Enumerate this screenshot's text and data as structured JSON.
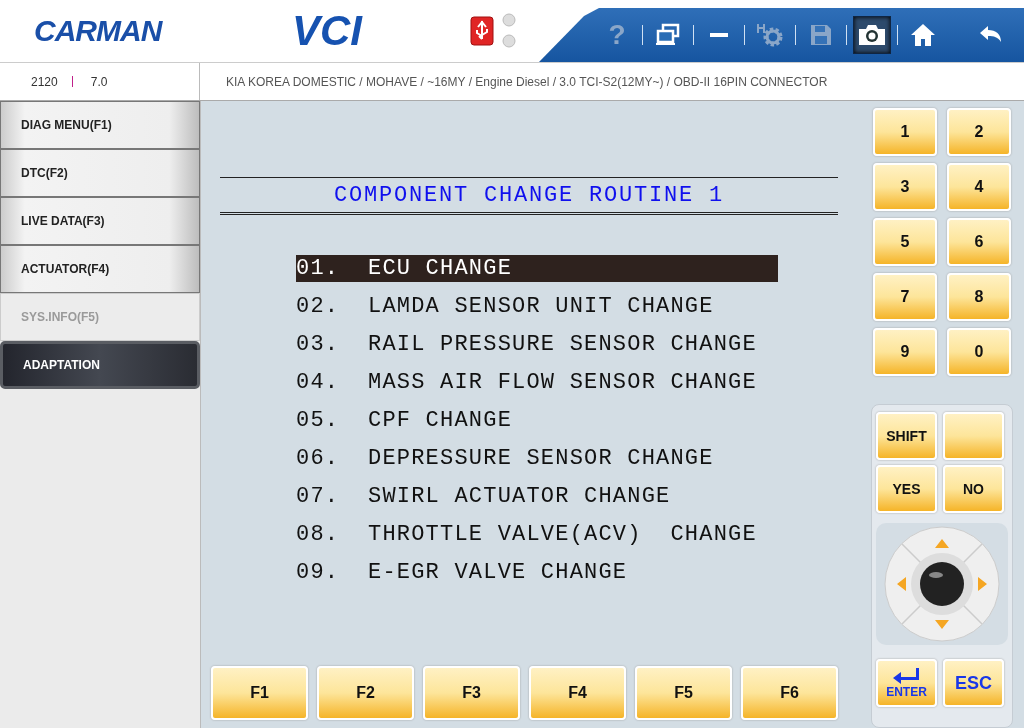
{
  "header": {
    "brand": "CARMAN",
    "product": "VCI",
    "toolbar": [
      {
        "kind": "help",
        "label": "?",
        "disabled": true,
        "selected": false
      },
      {
        "kind": "windows",
        "disabled": false,
        "selected": false
      },
      {
        "kind": "minimize",
        "disabled": false,
        "selected": false
      },
      {
        "kind": "settings",
        "disabled": true,
        "selected": false
      },
      {
        "kind": "save",
        "disabled": true,
        "selected": false
      },
      {
        "kind": "camera",
        "disabled": false,
        "selected": true
      },
      {
        "kind": "home",
        "disabled": false,
        "selected": false
      },
      {
        "kind": "back",
        "disabled": false,
        "selected": false
      }
    ]
  },
  "info_bar": {
    "code": "2120",
    "version": "7.0",
    "vehicle_path": "KIA KOREA DOMESTIC / MOHAVE / ~16MY / Engine Diesel / 3.0 TCI-S2(12MY~) / OBD-II 16PIN CONNECTOR"
  },
  "sidebar": {
    "items": [
      {
        "label": "DIAG MENU(F1)",
        "disabled": false,
        "selected": false
      },
      {
        "label": "DTC(F2)",
        "disabled": false,
        "selected": false
      },
      {
        "label": "LIVE DATA(F3)",
        "disabled": false,
        "selected": false
      },
      {
        "label": "ACTUATOR(F4)",
        "disabled": false,
        "selected": false
      },
      {
        "label": "SYS.INFO(F5)",
        "disabled": true,
        "selected": false
      },
      {
        "label": "ADAPTATION",
        "disabled": false,
        "selected": true
      }
    ]
  },
  "screen": {
    "title": "COMPONENT CHANGE ROUTINE 1",
    "items": [
      {
        "label": "01.  ECU CHANGE",
        "selected": true
      },
      {
        "label": "02.  LAMDA SENSOR UNIT CHANGE",
        "selected": false
      },
      {
        "label": "03.  RAIL PRESSURE SENSOR CHANGE",
        "selected": false
      },
      {
        "label": "04.  MASS AIR FLOW SENSOR CHANGE",
        "selected": false
      },
      {
        "label": "05.  CPF CHANGE",
        "selected": false
      },
      {
        "label": "06.  DEPRESSURE SENSOR CHANGE",
        "selected": false
      },
      {
        "label": "07.  SWIRL ACTUATOR CHANGE",
        "selected": false
      },
      {
        "label": "08.  THROTTLE VALVE(ACV)  CHANGE",
        "selected": false
      },
      {
        "label": "09.  E-EGR VALVE CHANGE",
        "selected": false
      }
    ]
  },
  "function_keys": [
    "F1",
    "F2",
    "F3",
    "F4",
    "F5",
    "F6"
  ],
  "keypad": {
    "digits": [
      "1",
      "2",
      "3",
      "4",
      "5",
      "6",
      "7",
      "8",
      "9",
      "0"
    ],
    "keys": [
      {
        "kind": "text",
        "label": "SHIFT"
      },
      {
        "kind": "blank"
      },
      {
        "kind": "text",
        "label": "YES"
      },
      {
        "kind": "text",
        "label": "NO"
      }
    ],
    "enter": "ENTER",
    "esc": "ESC"
  }
}
